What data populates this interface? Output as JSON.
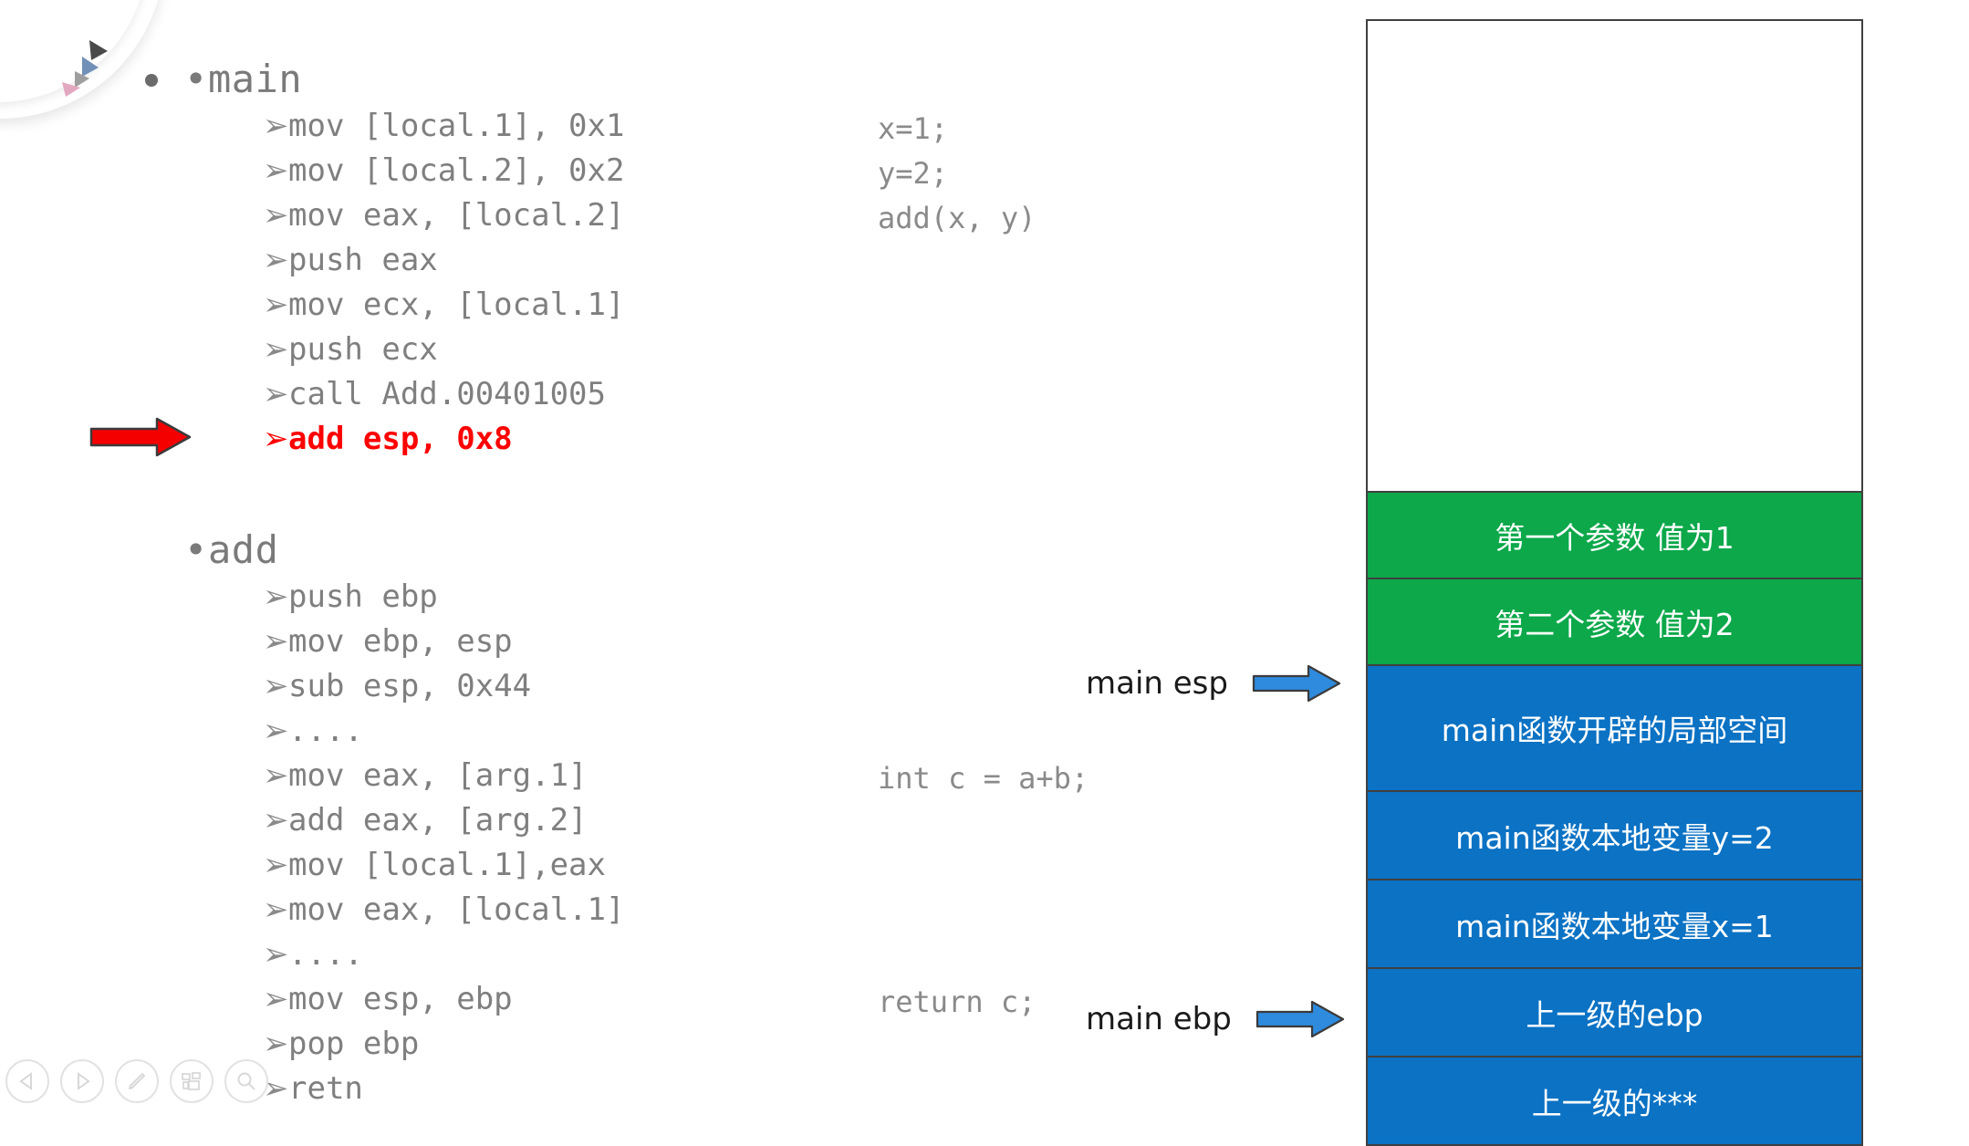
{
  "slide": {
    "sections": [
      {
        "title": "main",
        "lines": [
          {
            "code": "mov [local.1], 0x1",
            "comment": "x=1;",
            "highlight": false
          },
          {
            "code": "mov [local.2], 0x2",
            "comment": "y=2;",
            "highlight": false
          },
          {
            "code": "mov eax, [local.2]",
            "comment": "add(x, y)",
            "highlight": false
          },
          {
            "code": "push eax",
            "comment": "",
            "highlight": false
          },
          {
            "code": "mov ecx, [local.1]",
            "comment": "",
            "highlight": false
          },
          {
            "code": "push ecx",
            "comment": "",
            "highlight": false
          },
          {
            "code": "call Add.00401005",
            "comment": "",
            "highlight": false
          },
          {
            "code": "add esp, 0x8",
            "comment": "",
            "highlight": true
          }
        ]
      },
      {
        "title": "add",
        "lines": [
          {
            "code": "push ebp",
            "comment": "",
            "highlight": false
          },
          {
            "code": "mov ebp, esp",
            "comment": "",
            "highlight": false
          },
          {
            "code": "sub esp, 0x44",
            "comment": "",
            "highlight": false
          },
          {
            "code": "....",
            "comment": "",
            "highlight": false
          },
          {
            "code": "mov eax, [arg.1]",
            "comment": "int c = a+b;",
            "highlight": false
          },
          {
            "code": "add eax, [arg.2]",
            "comment": "",
            "highlight": false
          },
          {
            "code": "mov [local.1],eax",
            "comment": "",
            "highlight": false
          },
          {
            "code": "mov eax, [local.1]",
            "comment": "",
            "highlight": false
          },
          {
            "code": "....",
            "comment": "",
            "highlight": false
          },
          {
            "code": "mov esp, ebp",
            "comment": "return c;",
            "highlight": false
          },
          {
            "code": "pop ebp",
            "comment": "",
            "highlight": false
          },
          {
            "code": "retn",
            "comment": "",
            "highlight": false
          }
        ]
      }
    ],
    "bullet_glyph": "•",
    "sub_marker_glyph": "➢",
    "highlight_color": "#ff0000",
    "text_color": "#7f7f7f"
  },
  "stack": {
    "cells": [
      {
        "label": "",
        "fill": "empty",
        "color": "#ffffff"
      },
      {
        "label": "第一个参数 值为1",
        "fill": "green",
        "color": "#0CA84A"
      },
      {
        "label": "第二个参数 值为2",
        "fill": "green",
        "color": "#0CA84A"
      },
      {
        "label": "main函数开辟的局部空间",
        "fill": "blue",
        "color": "#0B72C4"
      },
      {
        "label": "main函数本地变量y=2",
        "fill": "blue",
        "color": "#0B72C4"
      },
      {
        "label": "main函数本地变量x=1",
        "fill": "blue",
        "color": "#0B72C4"
      },
      {
        "label": "上一级的ebp",
        "fill": "blue",
        "color": "#0B72C4"
      },
      {
        "label": "上一级的***",
        "fill": "blue",
        "color": "#0B72C4"
      }
    ],
    "border_color": "#404040"
  },
  "pointers": [
    {
      "label": "main esp",
      "arrow_color": "#2E8BDE"
    },
    {
      "label": "main ebp",
      "arrow_color": "#2E8BDE"
    }
  ],
  "navbar": {
    "buttons": [
      {
        "icon": "previous-slide-icon"
      },
      {
        "icon": "next-slide-icon"
      },
      {
        "icon": "pen-icon"
      },
      {
        "icon": "slide-grid-icon"
      },
      {
        "icon": "magnifier-icon"
      }
    ]
  }
}
